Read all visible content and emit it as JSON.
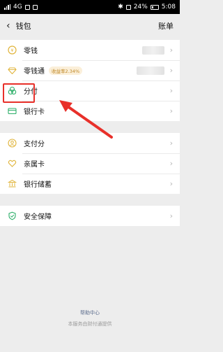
{
  "status_bar": {
    "left": "4G",
    "battery": "24%",
    "time": "5:08"
  },
  "nav": {
    "title": "钱包",
    "right_label": "账单"
  },
  "groups": [
    {
      "items": [
        {
          "label": "零钱",
          "icon": "coin-icon"
        },
        {
          "label": "零钱通",
          "icon": "diamond-icon",
          "badge": "收益率2.34%"
        },
        {
          "label": "分付",
          "icon": "fenfu-icon"
        },
        {
          "label": "银行卡",
          "icon": "bank-card-icon"
        }
      ]
    },
    {
      "items": [
        {
          "label": "支付分",
          "icon": "pay-score-icon"
        },
        {
          "label": "亲属卡",
          "icon": "family-card-icon"
        },
        {
          "label": "银行储蓄",
          "icon": "bank-savings-icon"
        }
      ]
    },
    {
      "items": [
        {
          "label": "安全保障",
          "icon": "shield-icon"
        }
      ]
    }
  ],
  "footer": {
    "help": "帮助中心",
    "powered_by": "本服务由财付通提供"
  },
  "colors": {
    "annotation": "#e8302a",
    "gold": "#e0b43a",
    "green": "#2aae67",
    "page_bg": "#ededed"
  }
}
